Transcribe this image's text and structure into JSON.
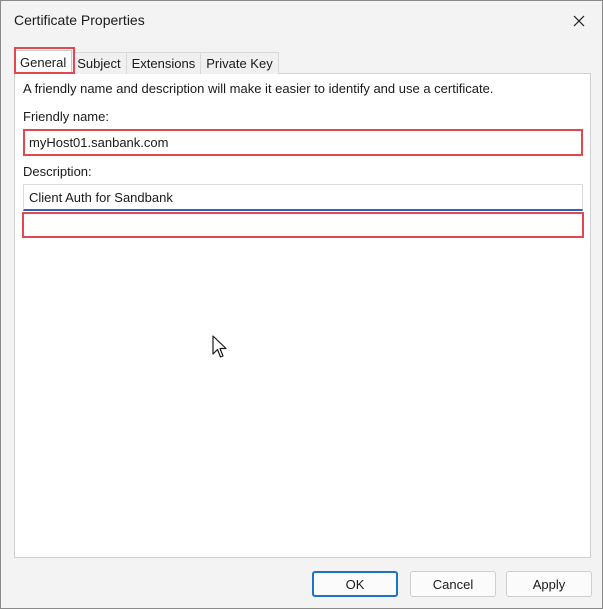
{
  "window": {
    "title": "Certificate Properties"
  },
  "tabs": [
    {
      "label": "General",
      "active": true
    },
    {
      "label": "Subject",
      "active": false
    },
    {
      "label": "Extensions",
      "active": false
    },
    {
      "label": "Private Key",
      "active": false
    }
  ],
  "general": {
    "intro": "A friendly name and description will make it easier to identify and use a certificate.",
    "friendly_name_label": "Friendly name:",
    "friendly_name_value": "myHost01.sanbank.com",
    "description_label": "Description:",
    "description_value": "Client Auth for Sandbank"
  },
  "buttons": {
    "ok": "OK",
    "cancel": "Cancel",
    "apply": "Apply"
  },
  "colors": {
    "highlight": "#e3484e",
    "focus_underline": "#2c62c2",
    "default_button_border": "#1a73c9"
  }
}
